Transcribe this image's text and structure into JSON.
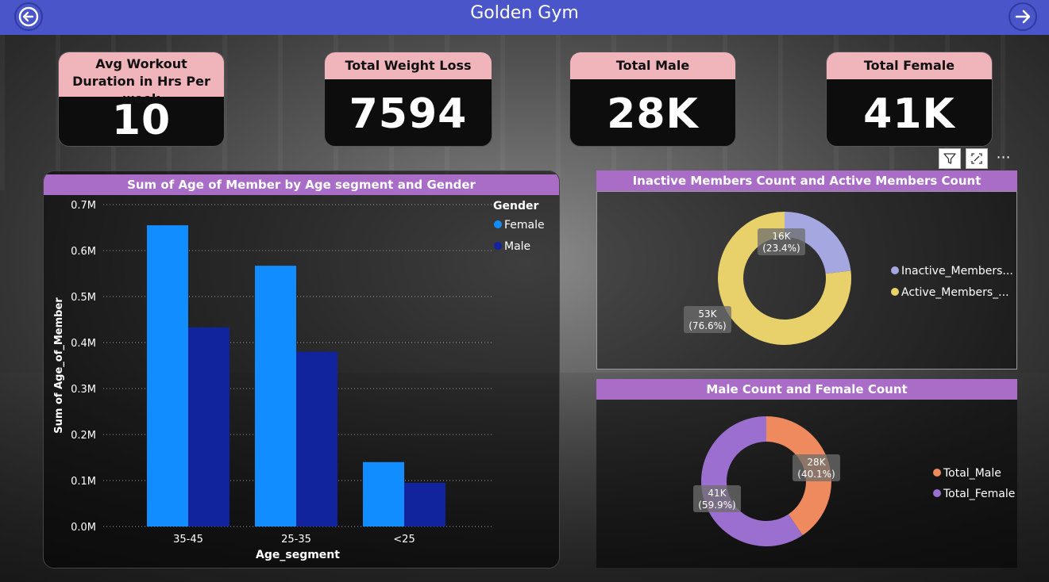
{
  "header": {
    "title": "Golden Gym"
  },
  "kpis": [
    {
      "label": "Avg Workout Duration in Hrs Per week",
      "value": "10"
    },
    {
      "label": "Total Weight Loss",
      "value": "7594"
    },
    {
      "label": "Total Male",
      "value": "28K"
    },
    {
      "label": "Total Female",
      "value": "41K"
    }
  ],
  "colors": {
    "female": "#118dff",
    "male": "#12239e",
    "inactive": "#a4a7e0",
    "active": "#e8d06a",
    "total_male": "#ef8a5e",
    "total_female": "#9b6fd0",
    "title_bar": "#a96cc7",
    "kpi_head": "#f0b4bb"
  },
  "icons": {
    "back": "arrow-left-circle-icon",
    "next": "arrow-right-icon",
    "filter": "filter-icon",
    "focus": "focus-mode-icon",
    "more": "more-options-icon"
  },
  "chart_data": [
    {
      "type": "bar",
      "title": "Sum of Age of Member by Age segment and Gender",
      "xlabel": "Age_segment",
      "ylabel": "Sum of Age_of_Member",
      "legend_title": "Gender",
      "legend_position": "top-right",
      "categories": [
        "35-45",
        "25-35",
        "<25"
      ],
      "series": [
        {
          "name": "Female",
          "values": [
            655000,
            567000,
            140000
          ]
        },
        {
          "name": "Male",
          "values": [
            433000,
            380000,
            95000
          ]
        }
      ],
      "ylim": [
        0,
        700000
      ],
      "yticks": [
        "0.0M",
        "0.1M",
        "0.2M",
        "0.3M",
        "0.4M",
        "0.5M",
        "0.6M",
        "0.7M"
      ],
      "grid": true
    },
    {
      "type": "pie",
      "title": "Inactive Members Count and Active Members Count",
      "legend_position": "right",
      "labels": [
        "Inactive_Members...",
        "Active_Members_..."
      ],
      "values": [
        16,
        53
      ],
      "value_labels": [
        "16K",
        "53K"
      ],
      "percent_labels": [
        "(23.4%)",
        "(76.6%)"
      ]
    },
    {
      "type": "pie",
      "title": "Male Count and Female Count",
      "legend_position": "right",
      "labels": [
        "Total_Male",
        "Total_Female"
      ],
      "values": [
        28,
        41
      ],
      "value_labels": [
        "28K",
        "41K"
      ],
      "percent_labels": [
        "(40.1%)",
        "(59.9%)"
      ]
    }
  ]
}
